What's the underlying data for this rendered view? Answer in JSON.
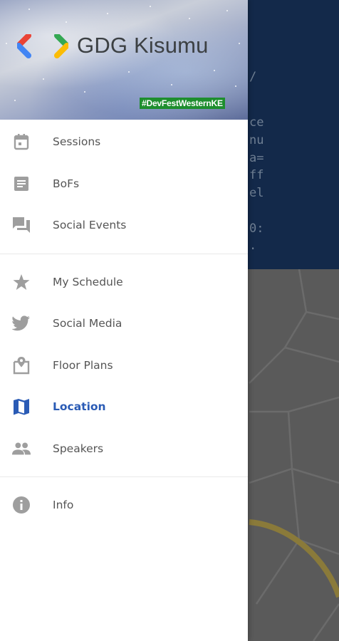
{
  "header": {
    "title": "GDG Kisumu",
    "hashtag": "#DevFestWesternKE"
  },
  "background_app": {
    "text_lines": [
      "/",
      "",
      "",
      "ce",
      "nu",
      "a=",
      "ff",
      "el",
      "",
      "0:",
      "."
    ]
  },
  "menu": {
    "group1": [
      {
        "label": "Sessions",
        "icon": "calendar-icon"
      },
      {
        "label": "BoFs",
        "icon": "document-icon"
      },
      {
        "label": "Social Events",
        "icon": "forum-icon"
      }
    ],
    "group2": [
      {
        "label": "My Schedule",
        "icon": "star-icon"
      },
      {
        "label": "Social Media",
        "icon": "twitter-icon"
      },
      {
        "label": "Floor Plans",
        "icon": "map-pin-icon"
      },
      {
        "label": "Location",
        "icon": "map-icon",
        "active": true
      },
      {
        "label": "Speakers",
        "icon": "people-icon"
      }
    ],
    "group3": [
      {
        "label": "Info",
        "icon": "info-icon"
      }
    ]
  },
  "colors": {
    "active": "#2a5bb5",
    "icon": "#9e9e9e",
    "hashtag_bg": "#1e8e2e"
  }
}
